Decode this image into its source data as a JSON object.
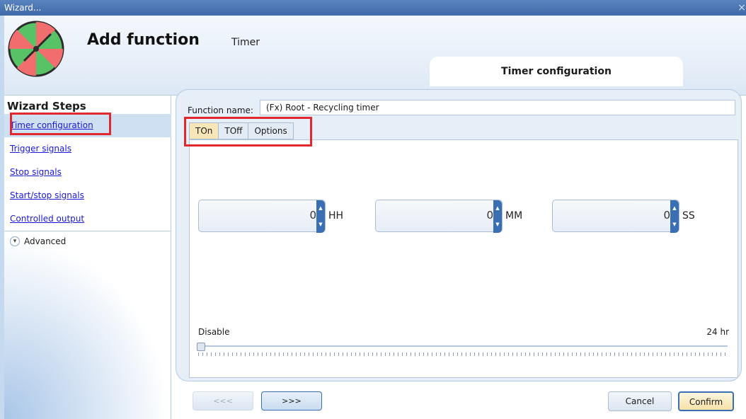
{
  "window": {
    "title": "Wizard...",
    "close_glyph": "×"
  },
  "header": {
    "title": "Add function",
    "subtitle": "Timer",
    "step_title": "Timer configuration",
    "logo_icon": "wheel-logo-icon"
  },
  "sidebar": {
    "title": "Wizard Steps",
    "items": [
      {
        "label": "Timer configuration",
        "active": true
      },
      {
        "label": "Trigger signals",
        "active": false
      },
      {
        "label": "Stop signals",
        "active": false
      },
      {
        "label": "Start/stop signals",
        "active": false
      },
      {
        "label": "Controlled output",
        "active": false
      }
    ],
    "advanced_label": "Advanced"
  },
  "form": {
    "function_name_label": "Function name:",
    "function_name_value": "(Fx) Root - Recycling timer",
    "tabs": [
      {
        "label": "TOn",
        "active": true
      },
      {
        "label": "TOff",
        "active": false
      },
      {
        "label": "Options",
        "active": false
      }
    ],
    "spinners": [
      {
        "value": "0",
        "unit": "HH"
      },
      {
        "value": "0",
        "unit": "MM"
      },
      {
        "value": "0",
        "unit": "SS"
      }
    ],
    "slider": {
      "min_label": "Disable",
      "max_label": "24 hr",
      "value_fraction": 0
    }
  },
  "footer": {
    "back_label": "<<<",
    "next_label": ">>>",
    "cancel_label": "Cancel",
    "confirm_label": "Confirm"
  },
  "colors": {
    "accent": "#3a6fb3",
    "highlight": "#e0282e",
    "active_tab": "#f9e6b8"
  }
}
